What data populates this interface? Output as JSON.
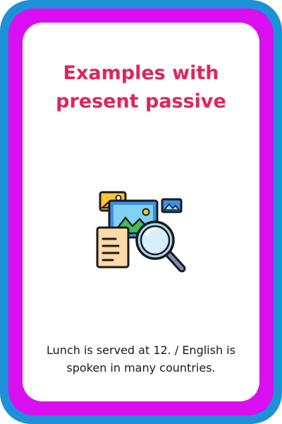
{
  "card": {
    "title_line1": "Examples with",
    "title_line2": "present passive",
    "caption": "Lunch is served at 12. / English is spoken in many countries."
  },
  "colors": {
    "outer_border": "#1e90d8",
    "inner_border": "#d90ff0",
    "title": "#e0245e"
  },
  "icons": {
    "illustration": "image-search-icon"
  }
}
